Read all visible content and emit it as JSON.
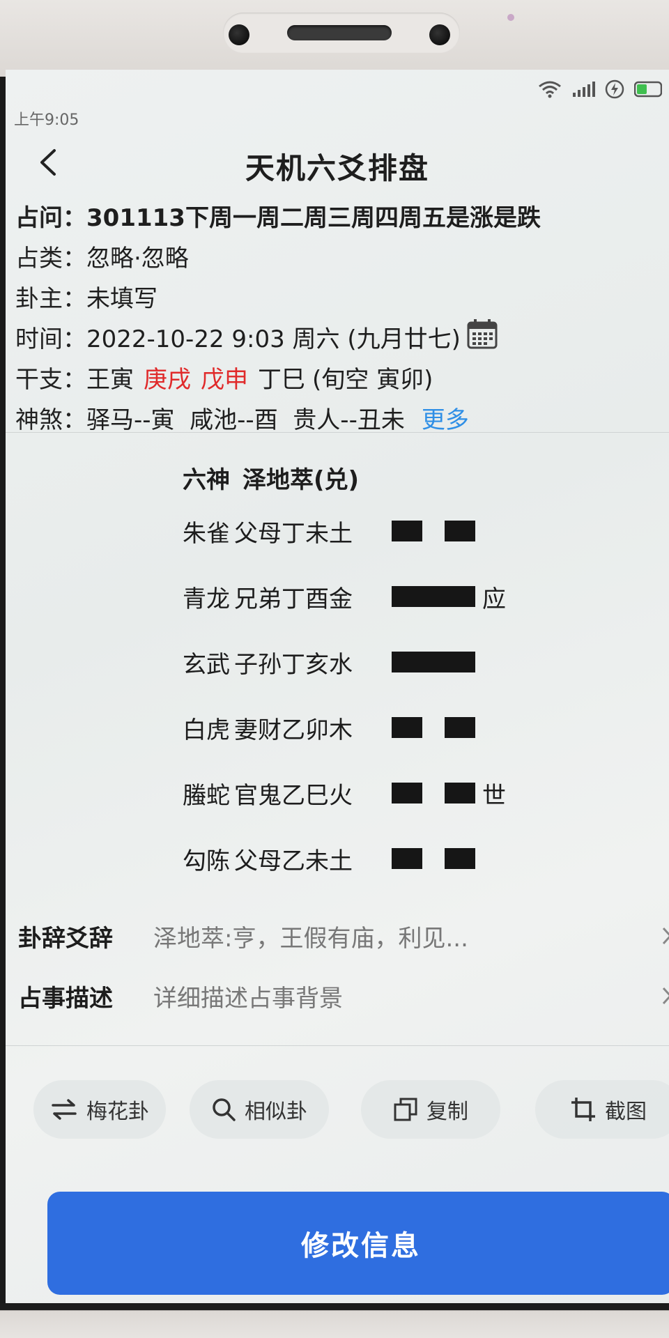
{
  "status_bar": {
    "time": "上午9:05",
    "icons": [
      "wifi-icon",
      "signal-icon",
      "charging-icon",
      "battery-icon"
    ]
  },
  "header": {
    "title": "天机六爻排盘",
    "back_icon": "chevron-left-icon"
  },
  "info": {
    "question": {
      "label": "占问：",
      "value": "301113下周一周二周三周四周五是涨是跌"
    },
    "category": {
      "label": "占类：",
      "value": "忽略·忽略"
    },
    "owner": {
      "label": "卦主：",
      "value": "未填写"
    },
    "time": {
      "label": "时间：",
      "value": "2022-10-22 9:03 周六 (九月廿七)",
      "icon": "calendar-icon"
    },
    "ganzhi": {
      "label": "干支：",
      "parts": [
        "王寅",
        "庚戌",
        "戊申",
        "丁巳",
        "(旬空 寅卯)"
      ],
      "highlight_color": "#e02a2a"
    },
    "shensha": {
      "label": "神煞：",
      "value": "驿马--寅  咸池--酉  贵人--丑未",
      "more": "更多"
    }
  },
  "gua": {
    "header_left": "六神",
    "header_right": "泽地萃(兑)",
    "yao": [
      {
        "god": "朱雀",
        "text": "父母丁未土",
        "type": "yin",
        "marker": ""
      },
      {
        "god": "青龙",
        "text": "兄弟丁酉金",
        "type": "yang",
        "marker": "应"
      },
      {
        "god": "玄武",
        "text": "子孙丁亥水",
        "type": "yang",
        "marker": ""
      },
      {
        "god": "白虎",
        "text": "妻财乙卯木",
        "type": "yin",
        "marker": ""
      },
      {
        "god": "螣蛇",
        "text": "官鬼乙巳火",
        "type": "yin",
        "marker": "世"
      },
      {
        "god": "勾陈",
        "text": "父母乙未土",
        "type": "yin",
        "marker": ""
      }
    ]
  },
  "details": {
    "guaci": {
      "label": "卦辞爻辞",
      "value": "泽地萃:亨，王假有庙，利见..."
    },
    "describe": {
      "label": "占事描述",
      "value": "详细描述占事背景"
    }
  },
  "actions": {
    "meihua": {
      "label": "梅花卦",
      "icon": "swap-icon"
    },
    "similar": {
      "label": "相似卦",
      "icon": "search-icon"
    },
    "copy": {
      "label": "复制",
      "icon": "copy-icon"
    },
    "screenshot": {
      "label": "截图",
      "icon": "crop-icon"
    }
  },
  "primary_button": {
    "label": "修改信息",
    "color": "#2f6ee0"
  }
}
